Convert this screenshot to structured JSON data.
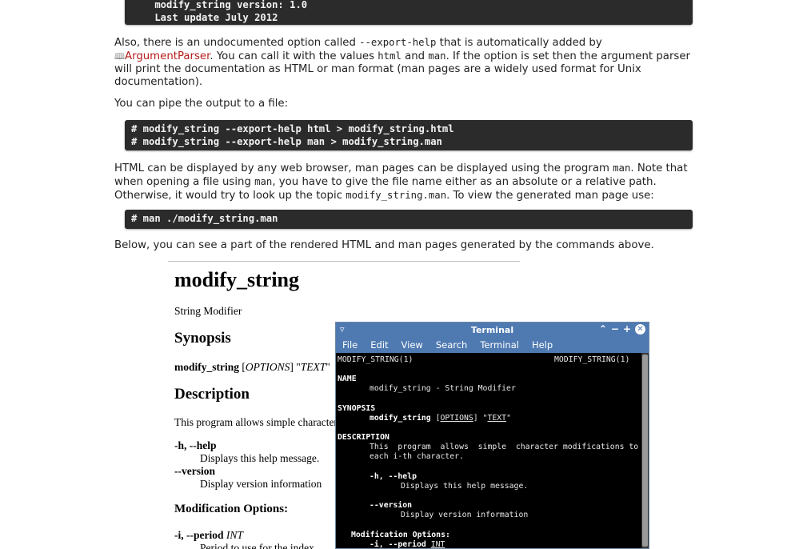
{
  "code_block_1": {
    "lines": [
      "    modify_string version: 1.0",
      "    Last update July 2012"
    ]
  },
  "para_export": {
    "prefix": "Also, there is an undocumented option called ",
    "option": "--export-help",
    "mid1": " that is automatically added by ",
    "link": "ArgumentParser",
    "mid2": ". You can call it with the values ",
    "val1": "html",
    "and": " and ",
    "val2": "man",
    "rest": ". If the option is set then the argument parser will print the documentation as HTML or man format (man pages are a widely used format for Unix documentation)."
  },
  "para_pipe": "You can pipe the output to a file:",
  "code_block_2": {
    "lines": [
      "# modify_string --export-help html > modify_string.html",
      "# modify_string --export-help man > modify_string.man"
    ]
  },
  "para_html": {
    "t1": "HTML can be displayed by any web browser, man pages can be displayed using the program ",
    "c1": "man",
    "t2": ". Note that when opening a file using ",
    "c2": "man",
    "t3": ", you have to give the file name either as an absolute or a relative path. Otherwise, it would try to look up the topic ",
    "c3": "modify_string.man",
    "t4": ". To view the generated man page use:"
  },
  "code_block_3": {
    "lines": [
      "# man ./modify_string.man"
    ]
  },
  "para_below": "Below, you can see a part of the rendered HTML and man pages generated by the commands above.",
  "rendered_html": {
    "title": "modify_string",
    "subtitle": "String Modifier",
    "synopsis_heading": "Synopsis",
    "synopsis_cmd": "modify_string",
    "synopsis_opts": "OPTIONS",
    "synopsis_text": "TEXT",
    "description_heading": "Description",
    "description_text": "This program allows simple character modifications to each i-th character.",
    "opt_help": "-h, --help",
    "opt_help_desc": "Displays this help message.",
    "opt_version": "--version",
    "opt_version_desc": "Display version information",
    "mod_heading": "Modification Options:",
    "opt_period": "-i, --period",
    "opt_period_arg": "INT",
    "opt_period_desc": "Period to use for the index."
  },
  "terminal": {
    "title": "Terminal",
    "menu": [
      "File",
      "Edit",
      "View",
      "Search",
      "Terminal",
      "Help"
    ],
    "header_left": "MODIFY_STRING(1)",
    "header_right": "MODIFY_STRING(1)",
    "name_heading": "NAME",
    "name_line": "modify_string - String Modifier",
    "synopsis_heading": "SYNOPSIS",
    "synopsis_cmd": "modify_string",
    "synopsis_opts": "OPTIONS",
    "synopsis_text": "TEXT",
    "description_heading": "DESCRIPTION",
    "desc_line1": "This  program  allows  simple  character modifications to",
    "desc_line2": "each i-th character.",
    "opt_help": "-h, --help",
    "opt_help_desc": "Displays this help message.",
    "opt_version": "--version",
    "opt_version_desc": "Display version information",
    "mod_heading": "Modification Options:",
    "opt_period": "-i, --period",
    "opt_period_arg": "INT"
  }
}
